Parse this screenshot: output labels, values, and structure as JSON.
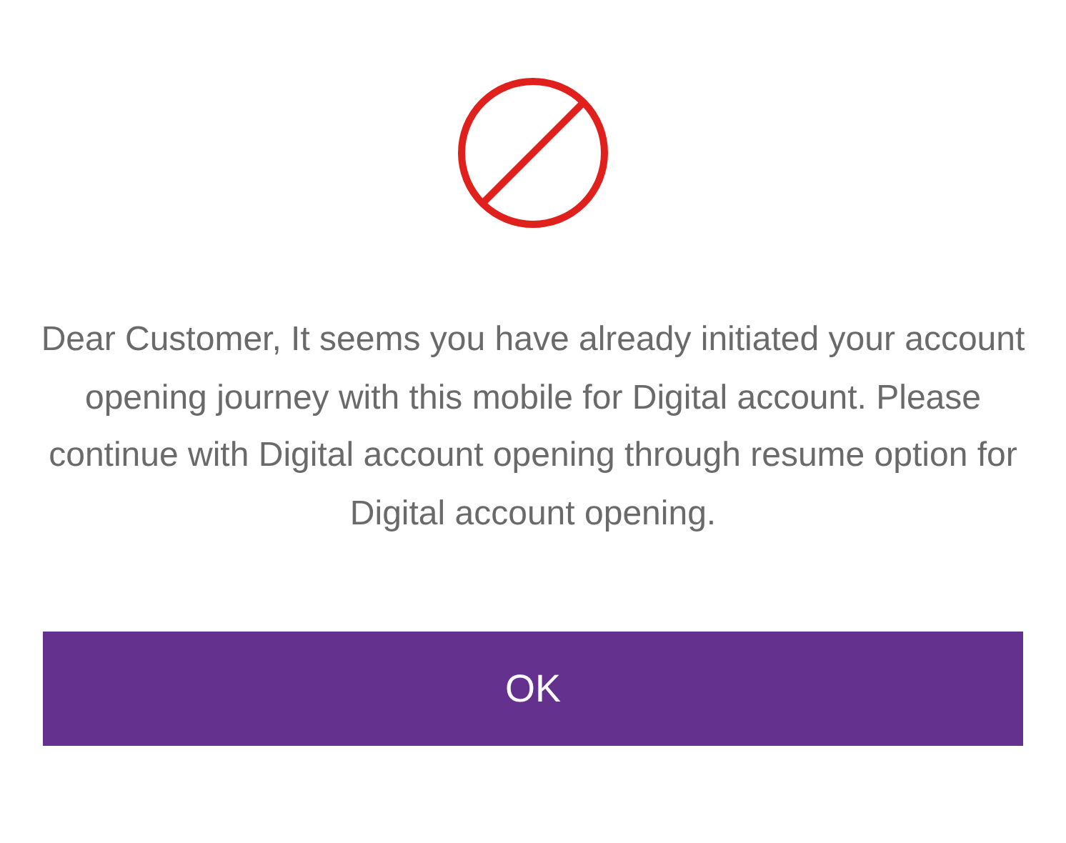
{
  "dialog": {
    "message": "Dear Customer, It seems you have already initiated your account opening journey with this mobile for Digital account. Please continue with Digital account opening through resume option for Digital account opening.",
    "buttons": [
      {
        "label": "OK"
      }
    ]
  }
}
